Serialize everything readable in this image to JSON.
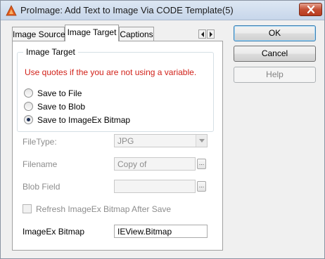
{
  "window": {
    "title": "ProImage: Add Text to Image Via CODE Template(5)"
  },
  "tabs": [
    {
      "label": "Image Source",
      "active": false
    },
    {
      "label": "Image Target",
      "active": true
    },
    {
      "label": "Captions",
      "active": false
    }
  ],
  "group": {
    "legend": "Image Target",
    "warning": "Use quotes if the you are not using a variable.",
    "warning_color": "#d1221a",
    "options": [
      {
        "label": "Save to File",
        "checked": false
      },
      {
        "label": "Save to Blob",
        "checked": false
      },
      {
        "label": "Save to ImageEx Bitmap",
        "checked": true
      }
    ]
  },
  "fields": {
    "filetype_label": "FileType:",
    "filetype_value": "JPG",
    "filename_label": "Filename",
    "filename_value": "Copy of",
    "blobfield_label": "Blob Field",
    "blobfield_value": "",
    "refresh_label": "Refresh ImageEx Bitmap After Save",
    "refresh_checked": false,
    "bitmap_label": "ImageEx Bitmap",
    "bitmap_value": "IEView.Bitmap"
  },
  "buttons": {
    "ok": "OK",
    "cancel": "Cancel",
    "help": "Help",
    "ellipsis": "..."
  },
  "icons": {
    "app": "proimage-app-icon",
    "close": "close-icon",
    "tab_left": "arrow-left-icon",
    "tab_right": "arrow-right-icon",
    "dropdown": "chevron-down-icon"
  }
}
